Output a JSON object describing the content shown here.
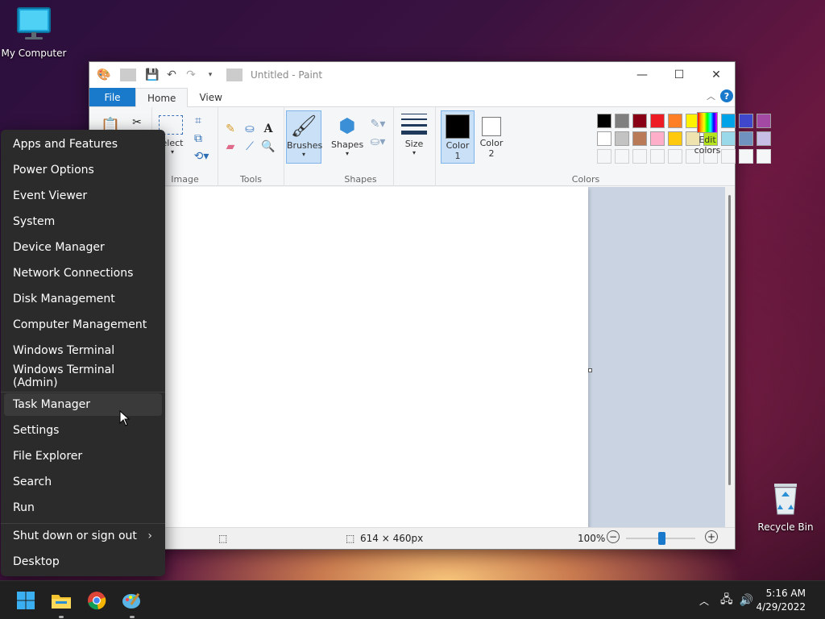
{
  "desktop": {
    "my_computer": "My Computer",
    "recycle_bin": "Recycle Bin"
  },
  "paint": {
    "title": "Untitled - Paint",
    "tabs": {
      "file": "File",
      "home": "Home",
      "view": "View"
    },
    "groups": {
      "image": "Image",
      "tools": "Tools",
      "shapes": "Shapes",
      "colors": "Colors"
    },
    "select_label": "elect",
    "brushes_label": "Brushes",
    "shapes_label": "Shapes",
    "size_label": "Size",
    "color1_label": "Color 1",
    "color2_label": "Color 2",
    "edit_colors_label": "Edit colors",
    "palette_row1": [
      "#000000",
      "#7f7f7f",
      "#880015",
      "#ed1c24",
      "#ff7f27",
      "#fff200",
      "#22b14c",
      "#00a2e8",
      "#3f48cc",
      "#a349a4"
    ],
    "palette_row2": [
      "#ffffff",
      "#c3c3c3",
      "#b97a57",
      "#ffaec9",
      "#ffc90e",
      "#efe4b0",
      "#b5e61d",
      "#99d9ea",
      "#7092be",
      "#c8bfe7"
    ],
    "status": {
      "dimensions": "614 × 460px",
      "zoom": "100%"
    }
  },
  "menu": {
    "items_top": [
      "Apps and Features",
      "Power Options",
      "Event Viewer",
      "System",
      "Device Manager",
      "Network Connections",
      "Disk Management",
      "Computer Management",
      "Windows Terminal",
      "Windows Terminal (Admin)"
    ],
    "items_mid": [
      "Task Manager",
      "Settings",
      "File Explorer",
      "Search",
      "Run"
    ],
    "shutdown": "Shut down or sign out",
    "desktop": "Desktop"
  },
  "taskbar": {
    "time": "5:16 AM",
    "date": "4/29/2022"
  }
}
